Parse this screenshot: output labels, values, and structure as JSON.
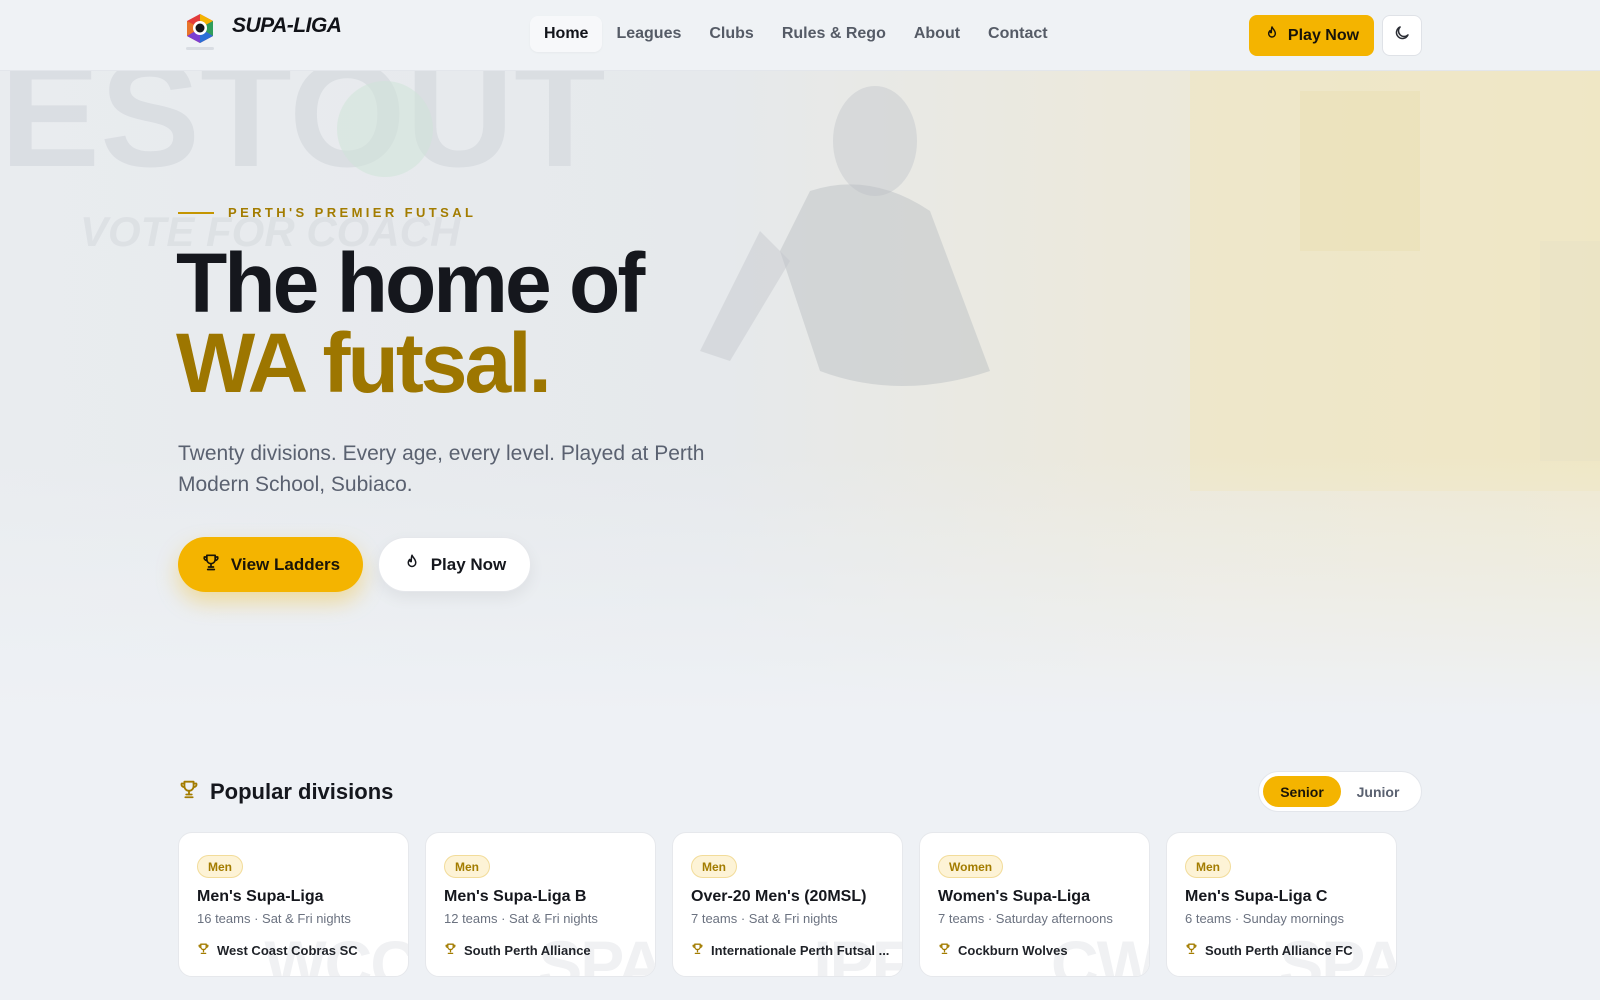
{
  "brand": {
    "name": "SUPA-LIGA"
  },
  "nav": {
    "items": [
      {
        "label": "Home",
        "active": true
      },
      {
        "label": "Leagues"
      },
      {
        "label": "Clubs"
      },
      {
        "label": "Rules & Rego"
      },
      {
        "label": "About"
      },
      {
        "label": "Contact"
      }
    ],
    "cta_label": "Play Now",
    "theme_icon": "moon-icon"
  },
  "hero": {
    "eyebrow": "PERTH'S PREMIER FUTSAL",
    "title_line1": "The home of",
    "title_line2": "WA futsal.",
    "subtitle": "Twenty divisions. Every age, every level. Played at Perth Modern School, Subiaco.",
    "primary_button": "View Ladders",
    "secondary_button": "Play Now",
    "background_text": "ESTOUT"
  },
  "divisions": {
    "title": "Popular divisions",
    "toggle": {
      "options": [
        "Senior",
        "Junior"
      ],
      "selected": "Senior"
    },
    "cards": [
      {
        "badge": "Men",
        "name": "Men's Supa-Liga",
        "meta": "16 teams · Sat & Fri nights",
        "leader": "West Coast Cobras SC",
        "watermark": "WCC"
      },
      {
        "badge": "Men",
        "name": "Men's Supa-Liga B",
        "meta": "12 teams · Sat & Fri nights",
        "leader": "South Perth Alliance",
        "watermark": "SPA"
      },
      {
        "badge": "Men",
        "name": "Over-20 Men's (20MSL)",
        "meta": "7 teams · Sat & Fri nights",
        "leader": "Internationale Perth Futsal ...",
        "watermark": "IPF"
      },
      {
        "badge": "Women",
        "name": "Women's Supa-Liga",
        "meta": "7 teams · Saturday afternoons",
        "leader": "Cockburn Wolves",
        "watermark": "CW"
      },
      {
        "badge": "Men",
        "name": "Men's Supa-Liga C",
        "meta": "6 teams · Sunday mornings",
        "leader": "South Perth Alliance FC",
        "watermark": "SPA"
      }
    ]
  },
  "colors": {
    "accent": "#f4b400",
    "accent_dark": "#9d7600",
    "text": "#15171d",
    "muted": "#5a6170",
    "background": "#eef1f5"
  }
}
